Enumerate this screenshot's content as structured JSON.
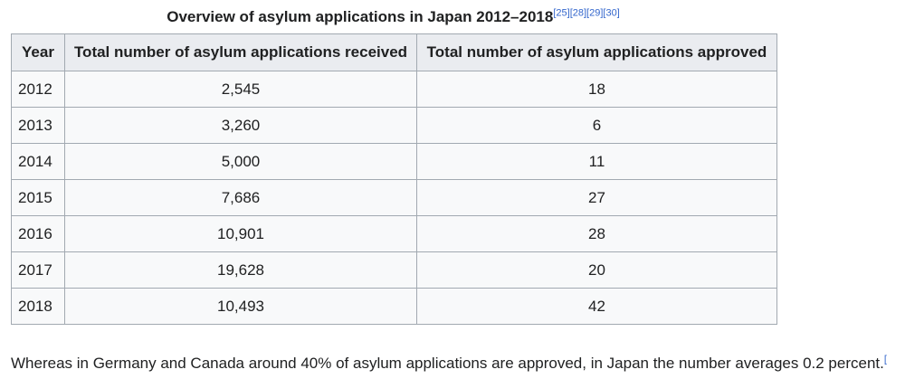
{
  "caption": {
    "title": "Overview of asylum applications in Japan 2012–2018",
    "refs": [
      "[25]",
      "[28]",
      "[29]",
      "[30]"
    ]
  },
  "table": {
    "headers": [
      "Year",
      "Total number of asylum applications received",
      "Total number of asylum applications approved"
    ],
    "rows": [
      [
        "2012",
        "2,545",
        "18"
      ],
      [
        "2013",
        "3,260",
        "6"
      ],
      [
        "2014",
        "5,000",
        "11"
      ],
      [
        "2015",
        "7,686",
        "27"
      ],
      [
        "2016",
        "10,901",
        "28"
      ],
      [
        "2017",
        "19,628",
        "20"
      ],
      [
        "2018",
        "10,493",
        "42"
      ]
    ]
  },
  "paragraph": {
    "text": "Whereas in Germany and Canada around 40% of asylum applications are approved, in Japan the number averages 0.2 percent.",
    "ref": "["
  }
}
